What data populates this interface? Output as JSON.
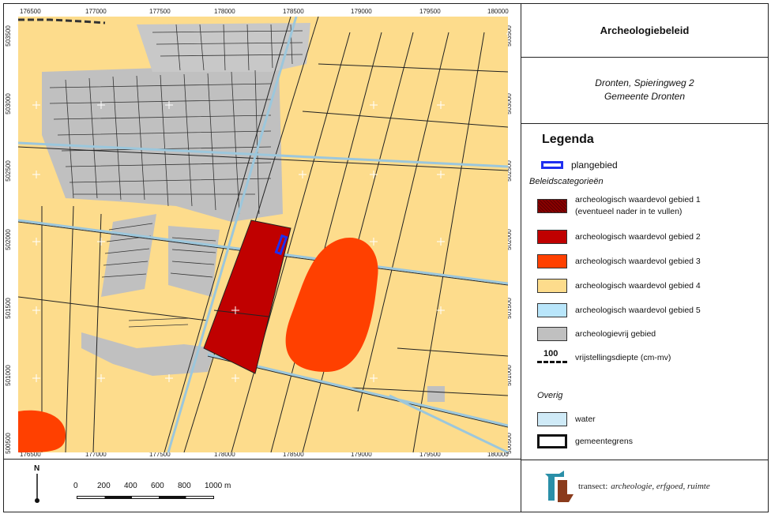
{
  "header": {
    "title": "Archeologiebeleid",
    "location_line1": "Dronten, Spieringweg 2",
    "location_line2": "Gemeente Dronten"
  },
  "map": {
    "x_ticks": [
      "176500",
      "177000",
      "177500",
      "178000",
      "178500",
      "179000",
      "179500",
      "180000"
    ],
    "y_ticks": [
      "503500",
      "503000",
      "502500",
      "502000",
      "501500",
      "501000",
      "500500"
    ],
    "colors": {
      "cat1": "#8b0000",
      "cat2": "#c00000",
      "cat3": "#ff4000",
      "cat4": "#fddc8c",
      "cat5": "#b9e6fb",
      "free": "#c0c0c0",
      "water": "#cfeaf7",
      "plangebied": "#1f2ff0"
    }
  },
  "legend": {
    "title": "Legenda",
    "plangebied": "plangebied",
    "subtitle": "Beleidscategorieën",
    "items": [
      {
        "label": "archeologisch waardevol gebied 1",
        "label2": "(eventueel nader in te vullen)",
        "color": "#8b0000"
      },
      {
        "label": "archeologisch waardevol gebied 2",
        "color": "#c00000"
      },
      {
        "label": "archeologisch waardevol gebied 3",
        "color": "#ff4000"
      },
      {
        "label": "archeologisch waardevol gebied 4",
        "color": "#fddc8c"
      },
      {
        "label": "archeologisch waardevol gebied 5",
        "color": "#b9e6fb"
      },
      {
        "label": "archeologievrij gebied",
        "color": "#c0c0c0"
      }
    ],
    "depth_value": "100",
    "depth_label": "vrijstellingsdiepte (cm-mv)",
    "other_title": "Overig",
    "water": "water",
    "municipality": "gemeentegrens"
  },
  "scale": {
    "north": "N",
    "labels": [
      "0",
      "200",
      "400",
      "600",
      "800",
      "1000 m"
    ]
  },
  "logo": {
    "brand": "transect:",
    "tagline": "archeologie, erfgoed, ruimte"
  }
}
